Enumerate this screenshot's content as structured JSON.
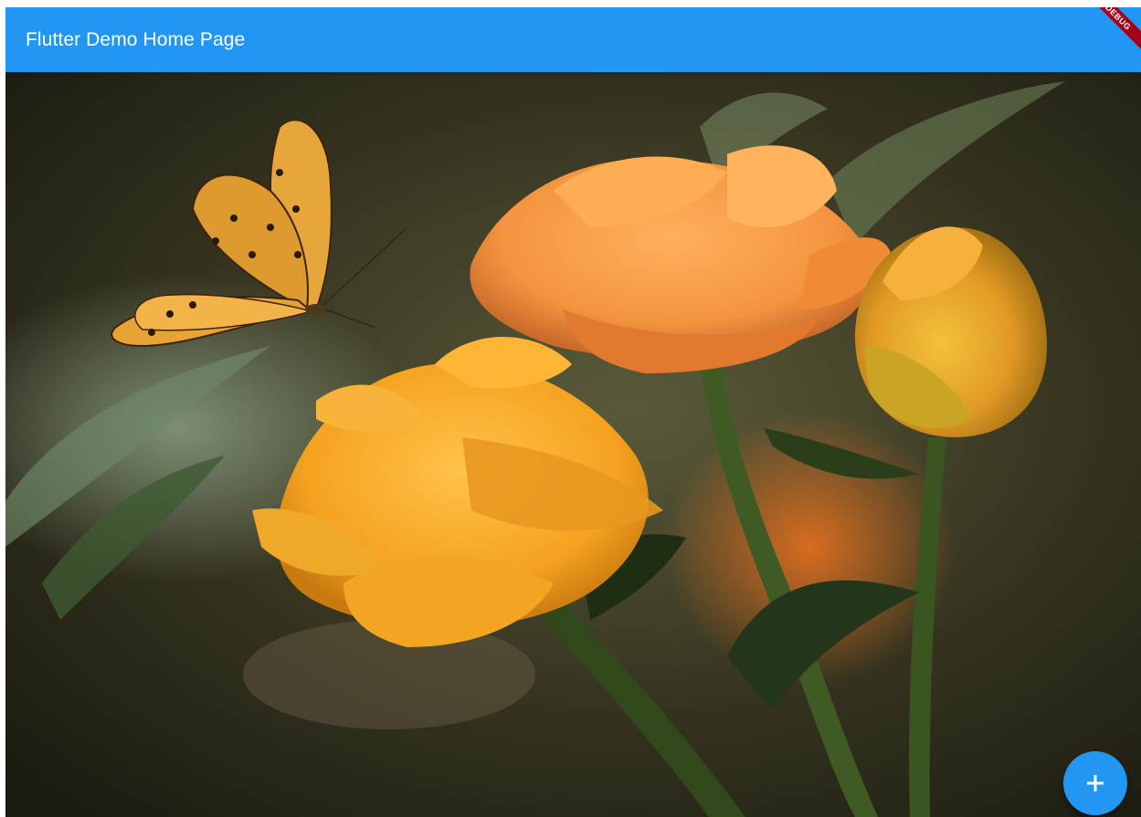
{
  "appbar": {
    "title": "Flutter Demo Home Page",
    "color": "#2196f3"
  },
  "debug_banner": {
    "label": "DEBUG",
    "color": "#a3001a"
  },
  "content": {
    "image_subject": "orange flowers with butterfly"
  },
  "fab": {
    "icon": "add-icon",
    "color": "#2196f3"
  }
}
